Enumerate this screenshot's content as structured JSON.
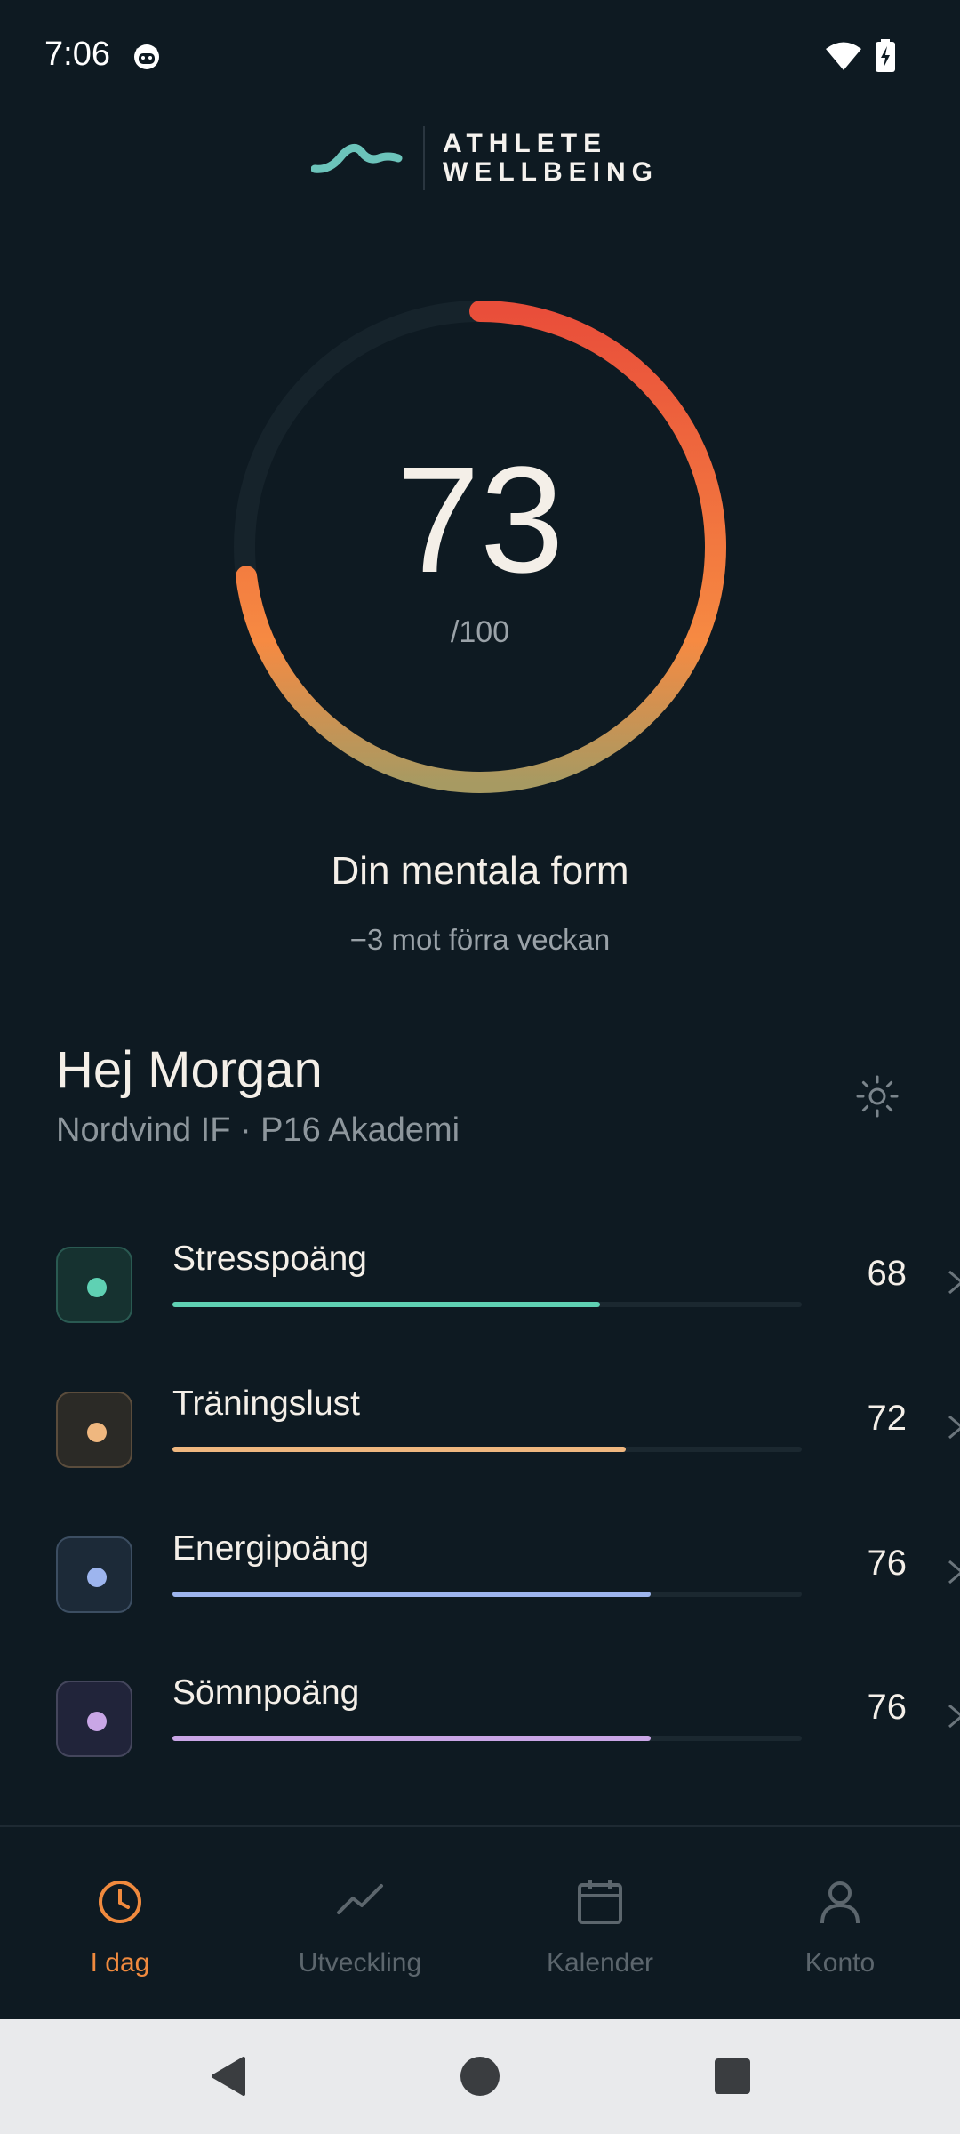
{
  "status_bar": {
    "time": "7:06"
  },
  "brand": {
    "line1": "ATHLETE",
    "line2": "WELLBEING",
    "accent": "#6cc4bb"
  },
  "score": {
    "value": "73",
    "max_label": "/100",
    "progress": 0.73,
    "title": "Din mentala form",
    "subtitle": "−3 mot förra veckan"
  },
  "profile": {
    "greeting": "Hej Morgan",
    "team": "Nordvind IF · P16 Akademi"
  },
  "metrics": [
    {
      "label": "Stresspoäng",
      "value": "68",
      "fraction": 0.68,
      "color": "#5fd1b3",
      "chip_bg": "#163230",
      "chip_border": "#2a5a52"
    },
    {
      "label": "Träningslust",
      "value": "72",
      "fraction": 0.72,
      "color": "#efb77f",
      "chip_bg": "#2b2a26",
      "chip_border": "#5a4c3c"
    },
    {
      "label": "Energipoäng",
      "value": "76",
      "fraction": 0.76,
      "color": "#9db5ee",
      "chip_bg": "#1c2a38",
      "chip_border": "#3c4e62"
    },
    {
      "label": "Sömnpoäng",
      "value": "76",
      "fraction": 0.76,
      "color": "#c9a6e6",
      "chip_bg": "#21243a",
      "chip_border": "#44465c"
    }
  ],
  "nav": {
    "items": [
      {
        "label": "I dag",
        "icon": "clock-icon",
        "active": true
      },
      {
        "label": "Utveckling",
        "icon": "trend-icon",
        "active": false
      },
      {
        "label": "Kalender",
        "icon": "calendar-icon",
        "active": false
      },
      {
        "label": "Konto",
        "icon": "person-icon",
        "active": false
      }
    ],
    "active_color": "#f08a3e",
    "inactive_color": "#5c666d"
  }
}
